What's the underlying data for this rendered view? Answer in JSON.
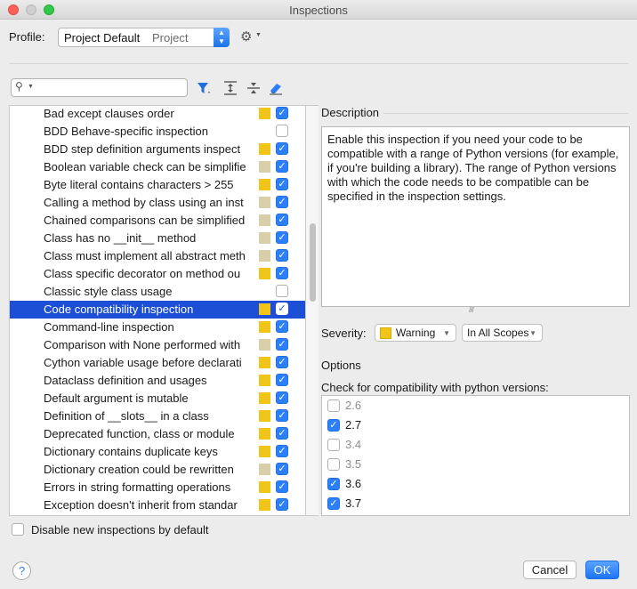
{
  "window": {
    "title": "Inspections"
  },
  "profile": {
    "label": "Profile:",
    "name": "Project Default",
    "scope": "Project"
  },
  "search": {
    "value": "",
    "placeholder": ""
  },
  "colors": {
    "warning": "#f0c419",
    "weak_warning": "#d8cfa8",
    "selection": "#1d4fd6",
    "accent": "#2d7ff9"
  },
  "inspections": [
    {
      "label": "Bad except clauses order",
      "severity": "warning",
      "checked": true
    },
    {
      "label": "BDD Behave-specific inspection",
      "severity": "none",
      "checked": false
    },
    {
      "label": "BDD step definition arguments inspect",
      "severity": "warning",
      "checked": true
    },
    {
      "label": "Boolean variable check can be simplifie",
      "severity": "weak",
      "checked": true
    },
    {
      "label": "Byte literal contains characters > 255",
      "severity": "warning",
      "checked": true
    },
    {
      "label": "Calling a method by class using an inst",
      "severity": "weak",
      "checked": true
    },
    {
      "label": "Chained comparisons can be simplified",
      "severity": "weak",
      "checked": true
    },
    {
      "label": "Class has no __init__ method",
      "severity": "weak",
      "checked": true
    },
    {
      "label": "Class must implement all abstract meth",
      "severity": "weak",
      "checked": true
    },
    {
      "label": "Class specific decorator on method ou",
      "severity": "warning",
      "checked": true
    },
    {
      "label": "Classic style class usage",
      "severity": "none",
      "checked": false
    },
    {
      "label": "Code compatibility inspection",
      "severity": "warning",
      "checked": true,
      "selected": true
    },
    {
      "label": "Command-line inspection",
      "severity": "warning",
      "checked": true
    },
    {
      "label": "Comparison with None performed with",
      "severity": "weak",
      "checked": true
    },
    {
      "label": "Cython variable usage before declarati",
      "severity": "warning",
      "checked": true
    },
    {
      "label": "Dataclass definition and usages",
      "severity": "warning",
      "checked": true
    },
    {
      "label": "Default argument is mutable",
      "severity": "warning",
      "checked": true
    },
    {
      "label": "Definition of __slots__ in a class",
      "severity": "warning",
      "checked": true
    },
    {
      "label": "Deprecated function, class or module",
      "severity": "warning",
      "checked": true
    },
    {
      "label": "Dictionary contains duplicate keys",
      "severity": "warning",
      "checked": true
    },
    {
      "label": "Dictionary creation could be rewritten",
      "severity": "weak",
      "checked": true
    },
    {
      "label": "Errors in string formatting operations",
      "severity": "warning",
      "checked": true
    },
    {
      "label": "Exception doesn't inherit from standar",
      "severity": "warning",
      "checked": true
    }
  ],
  "disable_new": {
    "label": "Disable new inspections by default",
    "checked": false
  },
  "description": {
    "heading": "Description",
    "text": "Enable this inspection if you need your code to be compatible with a range of Python versions (for example, if you're building a library). The range of Python versions with which the code needs to be compatible can be specified in the inspection settings."
  },
  "severity": {
    "label": "Severity:",
    "value": "Warning",
    "scope": "In All Scopes"
  },
  "options": {
    "heading": "Options",
    "compat_label": "Check for compatibility with python versions:",
    "versions": [
      {
        "label": "2.6",
        "checked": false
      },
      {
        "label": "2.7",
        "checked": true
      },
      {
        "label": "3.4",
        "checked": false
      },
      {
        "label": "3.5",
        "checked": false
      },
      {
        "label": "3.6",
        "checked": true
      },
      {
        "label": "3.7",
        "checked": true
      }
    ]
  },
  "buttons": {
    "help": "?",
    "cancel": "Cancel",
    "ok": "OK"
  }
}
